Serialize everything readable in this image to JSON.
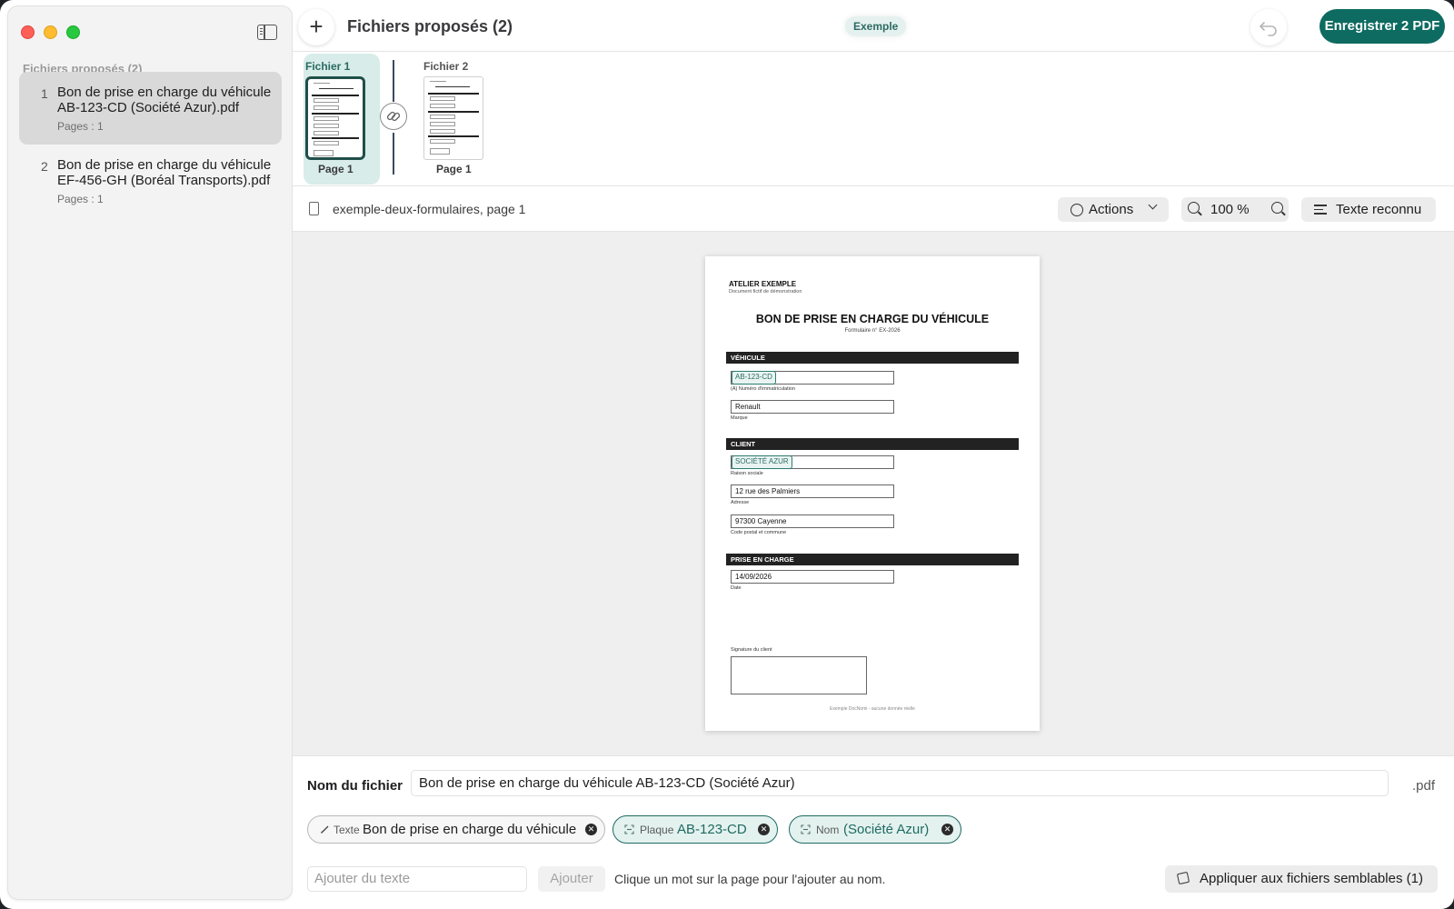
{
  "window": {
    "title": "Fichiers proposés (2)",
    "badge": "Exemple",
    "save_label": "Enregistrer 2 PDF"
  },
  "sidebar": {
    "heading": "Fichiers proposés (2)",
    "files": [
      {
        "num": "1",
        "name": "Bon de prise en charge du véhicule AB-123-CD (Société Azur).pdf",
        "pages": "Pages : 1",
        "selected": true
      },
      {
        "num": "2",
        "name": "Bon de prise en charge du véhicule EF-456-GH (Boréal Transports).pdf",
        "pages": "Pages : 1",
        "selected": false
      }
    ]
  },
  "strip": {
    "groups": [
      {
        "label": "Fichier 1",
        "page_label": "Page 1",
        "selected": true
      },
      {
        "label": "Fichier 2",
        "page_label": "Page 1",
        "selected": false
      }
    ]
  },
  "docbar": {
    "title": "exemple-deux-formulaires, page 1",
    "actions_label": "Actions",
    "zoom": "100 %",
    "text_label": "Texte reconnu"
  },
  "document": {
    "org": "ATELIER EXEMPLE",
    "org_sub": "Document fictif de démonstration",
    "title": "BON DE PRISE EN CHARGE DU VÉHICULE",
    "form_no": "Formulaire n° EX-2026",
    "sections": {
      "vehicle": "VÉHICULE",
      "client": "CLIENT",
      "pickup": "PRISE EN CHARGE"
    },
    "fields": {
      "plate": {
        "value": "AB-123-CD",
        "caption": "(A) Numéro d'immatriculation"
      },
      "brand": {
        "value": "Renault",
        "caption": "Marque"
      },
      "company": {
        "value": "SOCIÉTÉ AZUR",
        "caption": "Raison sociale"
      },
      "address": {
        "value": "12 rue des Palmiers",
        "caption": "Adresse"
      },
      "city": {
        "value": "97300 Cayenne",
        "caption": "Code postal et commune"
      },
      "date": {
        "value": "14/09/2026",
        "caption": "Date"
      }
    },
    "signature_caption": "Signature du client",
    "footer": "Exemple DocNomi - aucune donnée réelle"
  },
  "bottom": {
    "filename_label": "Nom du fichier",
    "filename_value": "Bon de prise en charge du véhicule AB-123-CD (Société Azur)",
    "extension": ".pdf",
    "chips": [
      {
        "kind": "Texte",
        "value": "Bon de prise en charge du véhicule",
        "icon": "pencil-icon"
      },
      {
        "kind": "Plaque",
        "value": "AB-123-CD",
        "icon": "scan-icon"
      },
      {
        "kind": "Nom",
        "value": "(Société Azur)",
        "icon": "scan-icon"
      }
    ],
    "add_placeholder": "Ajouter du texte",
    "add_button": "Ajouter",
    "hint": "Clique un mot sur la page pour l'ajouter au nom.",
    "apply_label": "Appliquer aux fichiers semblables (1)"
  },
  "colors": {
    "accent": "#0e6b61",
    "accent_light": "#e3f2ef",
    "sidebar_bg": "#f3f3f3",
    "selected_bg": "#d9d9d9"
  }
}
